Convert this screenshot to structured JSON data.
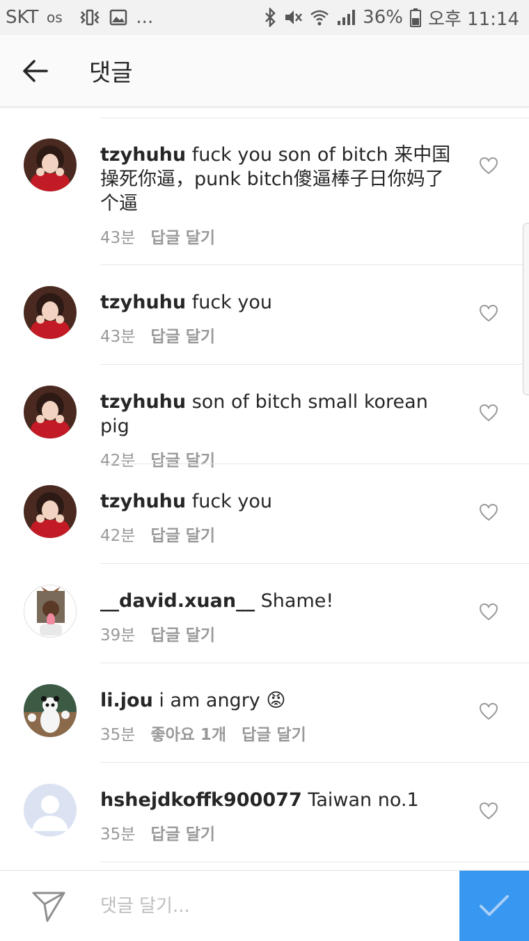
{
  "status_bar": {
    "carrier": "SKT",
    "extra": "...",
    "battery": "36%",
    "time": "오후 11:14"
  },
  "header": {
    "title": "댓글"
  },
  "comments": [
    {
      "username": "tzyhuhu",
      "text": "fuck you son of bitch 来中国操死你逼，punk bitch傻逼棒子日你妈了个逼",
      "time": "43분",
      "likes": "",
      "reply": "답글 달기",
      "avatar": "girl-photo"
    },
    {
      "username": "tzyhuhu",
      "text": "fuck you",
      "time": "43분",
      "likes": "",
      "reply": "답글 달기",
      "avatar": "girl-photo"
    },
    {
      "username": "tzyhuhu",
      "text": "son of bitch small korean pig",
      "time": "42분",
      "likes": "",
      "reply": "답글 달기",
      "avatar": "girl-photo"
    },
    {
      "username": "tzyhuhu",
      "text": "fuck you",
      "time": "42분",
      "likes": "",
      "reply": "답글 달기",
      "avatar": "girl-photo"
    },
    {
      "username": "__david.xuan__",
      "text": "Shame!",
      "time": "39분",
      "likes": "",
      "reply": "답글 달기",
      "avatar": "boy-dog-filter"
    },
    {
      "username": "li.jou",
      "text": "i am angry 😡",
      "time": "35분",
      "likes": "좋아요 1개",
      "reply": "답글 달기",
      "avatar": "panda-photo"
    },
    {
      "username": "hshejdkoffk900077",
      "text": "Taiwan no.1",
      "time": "35분",
      "likes": "",
      "reply": "답글 달기",
      "avatar": "default-avatar"
    }
  ],
  "compose": {
    "placeholder": "댓글 달기..."
  },
  "colors": {
    "accent": "#3897f0",
    "meta": "#999999",
    "text": "#262626"
  }
}
